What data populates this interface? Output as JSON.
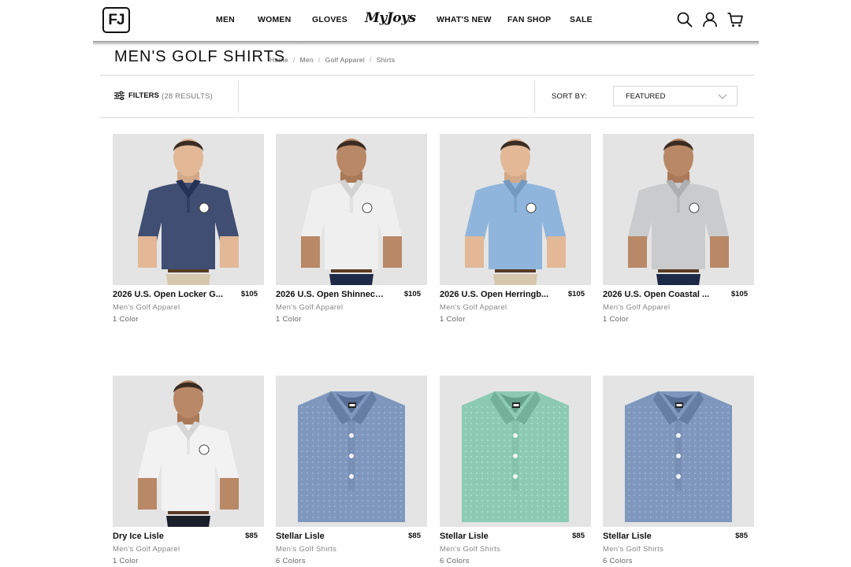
{
  "header": {
    "logo_text": "FJ",
    "nav": [
      {
        "label": "MEN"
      },
      {
        "label": "WOMEN"
      },
      {
        "label": "GLOVES"
      },
      {
        "label": "MyJoys"
      },
      {
        "label": "WHAT'S NEW"
      },
      {
        "label": "FAN SHOP"
      },
      {
        "label": "SALE"
      }
    ],
    "icons": [
      "search-icon",
      "account-icon",
      "cart-icon"
    ]
  },
  "page": {
    "title": "MEN'S GOLF SHIRTS",
    "breadcrumb": [
      "Home",
      "Men",
      "Golf Apparel",
      "Shirts"
    ]
  },
  "filter_bar": {
    "filters_label": "FILTERS",
    "results": "(28 RESULTS)",
    "sort_label": "SORT BY:",
    "sort_value": "FEATURED"
  },
  "products": [
    {
      "title": "2026 U.S. Open Locker G...",
      "price": "$105",
      "category": "Men's Golf Apparel",
      "colors": "1 Color",
      "image": "model",
      "shirt_color": "#3f4e72",
      "pants_color": "#d5c6ad",
      "skin": "#e2b897"
    },
    {
      "title": "2026 U.S. Open Shinneco...",
      "price": "$105",
      "category": "Men's Golf Apparel",
      "colors": "1 Color",
      "image": "model",
      "shirt_color": "#efefef",
      "pants_color": "#1d2a47",
      "skin": "#b98866"
    },
    {
      "title": "2026 U.S. Open Herringb...",
      "price": "$105",
      "category": "Men's Golf Apparel",
      "colors": "1 Color",
      "image": "model",
      "shirt_color": "#8fb5dc",
      "pants_color": "#d5c6ad",
      "skin": "#e2b897"
    },
    {
      "title": "2026 U.S. Open Coastal ...",
      "price": "$105",
      "category": "Men's Golf Apparel",
      "colors": "1 Color",
      "image": "model",
      "shirt_color": "#c9cbcd",
      "pants_color": "#1d2a47",
      "skin": "#b98866"
    },
    {
      "title": "Dry Ice Lisle",
      "price": "$85",
      "category": "Men's Golf Apparel",
      "colors": "1 Color",
      "image": "model",
      "shirt_color": "#f2f2f2",
      "pants_color": "#1b1f2a",
      "skin": "#b98866"
    },
    {
      "title": "Stellar Lisle",
      "price": "$85",
      "category": "Men's Golf Shirts",
      "colors": "6 Colors",
      "image": "folded",
      "shirt_color": "#7f97bd"
    },
    {
      "title": "Stellar Lisle",
      "price": "$85",
      "category": "Men's Golf Shirts",
      "colors": "6 Colors",
      "image": "folded",
      "shirt_color": "#8ccab4"
    },
    {
      "title": "Stellar Lisle",
      "price": "$85",
      "category": "Men's Golf Shirts",
      "colors": "6 Colors",
      "image": "folded",
      "shirt_color": "#7f97bd"
    }
  ]
}
